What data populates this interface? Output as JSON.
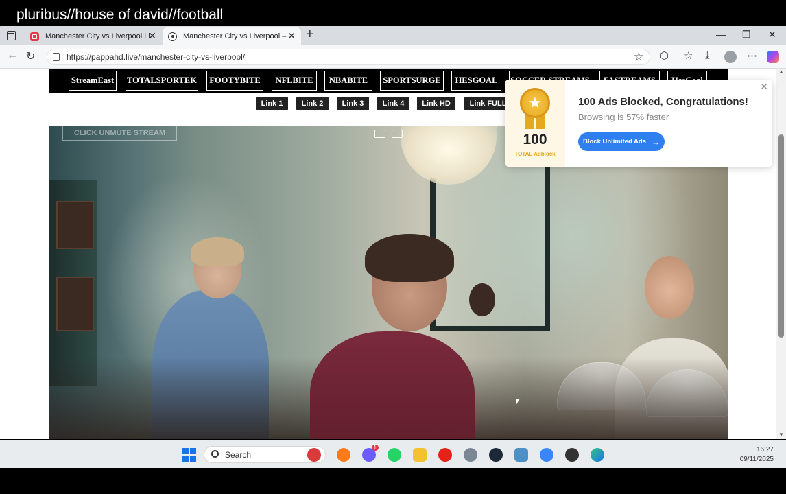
{
  "caption": "pluribus//house of david//football",
  "browser": {
    "tabs": [
      {
        "title": "Manchester City vs Liverpool Live"
      },
      {
        "title": "Manchester City vs Liverpool – pa"
      }
    ],
    "url": "https://pappahd.live/manchester-city-vs-liverpool/"
  },
  "site": {
    "nav_links": [
      "StreamEast",
      "TOTALSPORTEK",
      "FOOTYBITE",
      "NFLBITE",
      "NBABITE",
      "SPORTSURGE",
      "HESGOAL",
      "SOCCER STREAMS",
      "FASTREAMS",
      "HesGoal"
    ],
    "stream_links": [
      "Link 1",
      "Link 2",
      "Link 3",
      "Link 4",
      "Link HD",
      "Link FULLHD"
    ],
    "video_overlay_button": "CLICK UNMUTE STREAM"
  },
  "ad_popup": {
    "count": "100",
    "total_label": "TOTAL Adblock",
    "title": "100 Ads Blocked, Congratulations!",
    "subtitle": "Browsing is 57% faster",
    "button": "Block Unlimited Ads",
    "accent": "#2f7ff0"
  },
  "taskbar": {
    "search_placeholder": "Search",
    "time": "16:27",
    "date": "09/11/2025",
    "messenger_badge": "1"
  }
}
